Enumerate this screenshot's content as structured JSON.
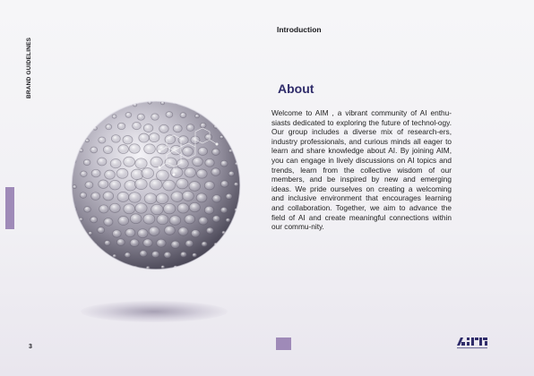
{
  "sidebar": {
    "label": "BRAND GUIDELINES"
  },
  "page": {
    "number": "3",
    "section": "Introduction"
  },
  "content": {
    "heading": "About",
    "paragraph": "Welcome to AIM , a vibrant community of AI enthu-siasts dedicated to exploring the future of technol-ogy. Our group includes a diverse mix of research-ers, industry professionals, and curious minds all eager to learn and share knowledge about AI. By joining AIM, you can engage in lively discussions on AI topics and trends, learn from the collective wisdom of our members, and be inspired by new and emerging ideas. We pride ourselves on creating a welcoming and inclusive environment that encourages learning and collaboration. Together, we aim to advance the field of AI and create meaningful connections within our commu-nity."
  },
  "colors": {
    "accent": "#9f8ab8",
    "heading": "#2f2c6a"
  },
  "graphics": {
    "hero": "cellular-sphere-image",
    "logo": "aim-logo"
  }
}
